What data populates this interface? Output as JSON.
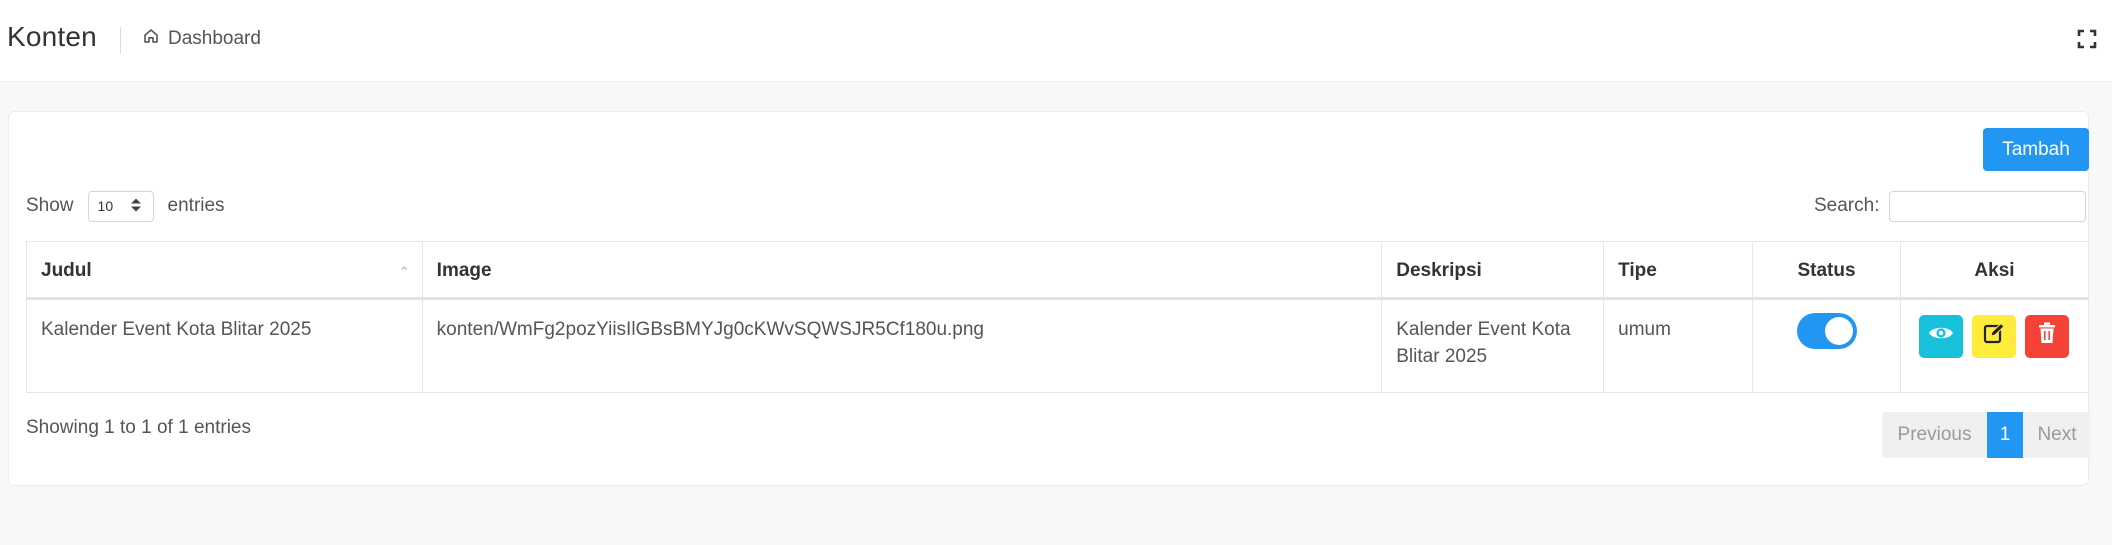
{
  "header": {
    "title": "Konten",
    "breadcrumb": {
      "label": "Dashboard",
      "icon": "home-icon"
    },
    "fullscreen_icon": "fullscreen-icon"
  },
  "toolbar": {
    "add_label": "Tambah"
  },
  "length_menu": {
    "show_label": "Show",
    "selected": "10",
    "entries_label": "entries"
  },
  "search": {
    "label": "Search:",
    "value": ""
  },
  "table": {
    "columns": [
      "Judul",
      "Image",
      "Deskripsi",
      "Tipe",
      "Status",
      "Aksi"
    ],
    "rows": [
      {
        "judul": "Kalender Event Kota Blitar 2025",
        "image": "konten/WmFg2pozYiisIlGBsBMYJg0cKWvSQWSJR5Cf180u.png",
        "deskripsi_line1": "Kalender Event Kota",
        "deskripsi_line2": "Blitar 2025",
        "tipe": "umum",
        "status_on": true
      }
    ]
  },
  "info": "Showing 1 to 1 of 1 entries",
  "pagination": {
    "previous": "Previous",
    "current": "1",
    "next": "Next"
  },
  "colors": {
    "primary": "#2196f3",
    "view": "#17c1dc",
    "edit": "#ffeb3b",
    "delete": "#f44336"
  }
}
